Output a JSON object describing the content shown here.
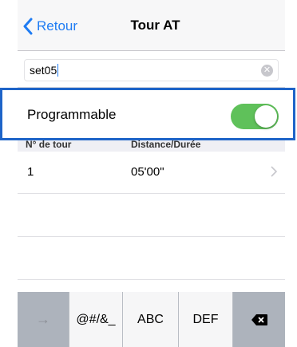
{
  "nav": {
    "back_label": "Retour",
    "title": "Tour AT"
  },
  "name_field": {
    "value": "set05",
    "clear_glyph": "✕"
  },
  "programmable": {
    "label": "Programmable",
    "enabled": true,
    "accent_color": "#5fc15a"
  },
  "table": {
    "headers": [
      "N° de tour",
      "Distance/Durée"
    ],
    "rows": [
      {
        "number": "1",
        "distance": "05'00\""
      }
    ]
  },
  "keyboard": {
    "keys": [
      "→",
      "@#/&_",
      "ABC",
      "DEF",
      "delete-icon"
    ]
  },
  "colors": {
    "link": "#1f7cf3",
    "highlight": "#1e64c8"
  }
}
